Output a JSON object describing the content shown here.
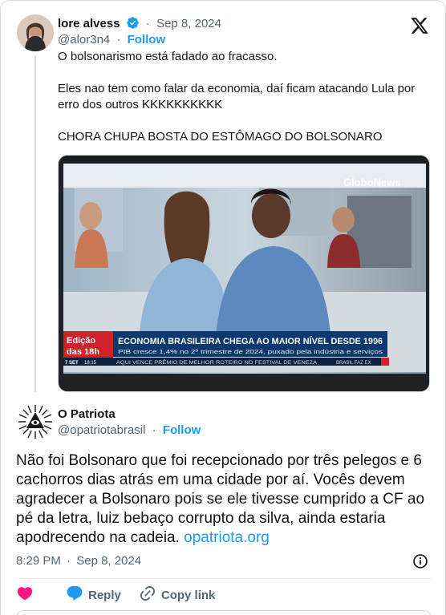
{
  "parent_tweet": {
    "author_name": "lore alvess",
    "separator": "·",
    "date": "Sep 8, 2024",
    "handle": "@alor3n4",
    "follow_label": "Follow",
    "text_lines": [
      "O bolsonarismo está fadado ao fracasso.",
      "",
      "Eles nao tem como falar da economia, daí ficam atacando Lula por erro dos outros KKKKKKKKKK",
      "",
      "CHORA CHUPA BOSTA DO ESTÔMAGO DO BOLSONARO"
    ],
    "media": {
      "headline": "ECONOMIA BRASILEIRA CHEGA AO MAIOR NÍVEL DESDE 1996",
      "subline": "PIB cresce 1,4% no 2º trimestre de 2024, puxado pela indústria e serviços",
      "program_label_1": "Edição",
      "program_label_2": "das 18h",
      "date_tag": "7 SET",
      "time_tag": "18:15",
      "ticker": "AQUI VENCE PRÊMIO DE MELHOR ROTEIRO NO FESTIVAL DE VENEZA",
      "ticker_right": "BRASIL FAZ EX",
      "channel_logo": "GloboNews"
    }
  },
  "main_tweet": {
    "author_name": "O Patriota",
    "handle": "@opatriotabrasil",
    "separator": "·",
    "follow_label": "Follow",
    "text": "Não foi Bolsonaro que foi recepcionado por três pelegos e 6 cachorros dias atrás em uma cidade por aí. Vocês devem agradecer a Bolsonaro pois se ele tivesse cumprido a CF ao pé da letra, luiz bebaço corrupto da silva, ainda estaria apodrecendo na cadeia.",
    "link_text": "opatriota.org",
    "time": "8:29 PM",
    "date": "Sep 8, 2024",
    "actions": {
      "reply_label": "Reply",
      "copy_link_label": "Copy link"
    }
  },
  "colors": {
    "accent": "#1d9bf0",
    "like": "#f91880",
    "muted": "#536471",
    "text": "#0f1419"
  },
  "icons": [
    "verified-badge-icon",
    "x-logo-icon",
    "info-icon",
    "heart-icon",
    "reply-bubble-icon",
    "link-icon"
  ]
}
